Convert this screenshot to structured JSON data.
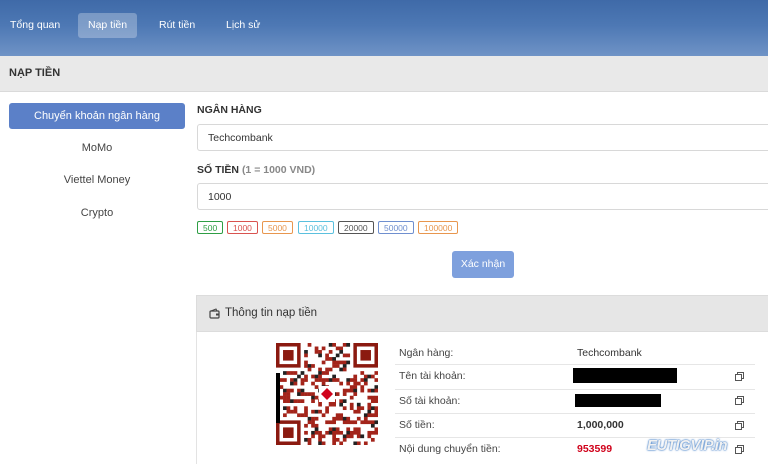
{
  "nav": {
    "tabs": [
      {
        "label": "Tổng quan"
      },
      {
        "label": "Nạp tiền"
      },
      {
        "label": "Rút tiền"
      },
      {
        "label": "Lịch sử"
      }
    ],
    "active_index": 1
  },
  "page": {
    "title": "NẠP TIỀN"
  },
  "methods": [
    {
      "label": "Chuyển khoản ngân hàng"
    },
    {
      "label": "MoMo"
    },
    {
      "label": "Viettel Money"
    },
    {
      "label": "Crypto"
    }
  ],
  "form": {
    "bank_label": "NGÂN HÀNG",
    "bank_value": "Techcombank",
    "amount_label": "SỐ TIỀN",
    "amount_hint": "(1 = 1000 VND)",
    "amount_value": "1000",
    "presets": [
      "500",
      "1000",
      "5000",
      "10000",
      "20000",
      "50000",
      "100000"
    ],
    "preset_colors": [
      "#2e9e44",
      "#d9534f",
      "#e8964e",
      "#5bc0de",
      "#555555",
      "#6f8fcf",
      "#e8964e"
    ],
    "confirm_label": "Xác nhận"
  },
  "info": {
    "title": "Thông tin nạp tiền",
    "rows": [
      {
        "label": "Ngân hàng:",
        "value": "Techcombank"
      },
      {
        "label": "Tên tài khoản:",
        "value": ""
      },
      {
        "label": "Số tài khoản:",
        "value": ""
      },
      {
        "label": "Số tiền:",
        "value": "1,000,000"
      },
      {
        "label": "Nội dung chuyển tiền:",
        "value": "953599"
      }
    ],
    "content_color": "#d0021b"
  },
  "watermark": {
    "text": "EUTIGVIP.in"
  },
  "colors": {
    "accent": "#5b80c8",
    "button": "#7ea0dd"
  }
}
